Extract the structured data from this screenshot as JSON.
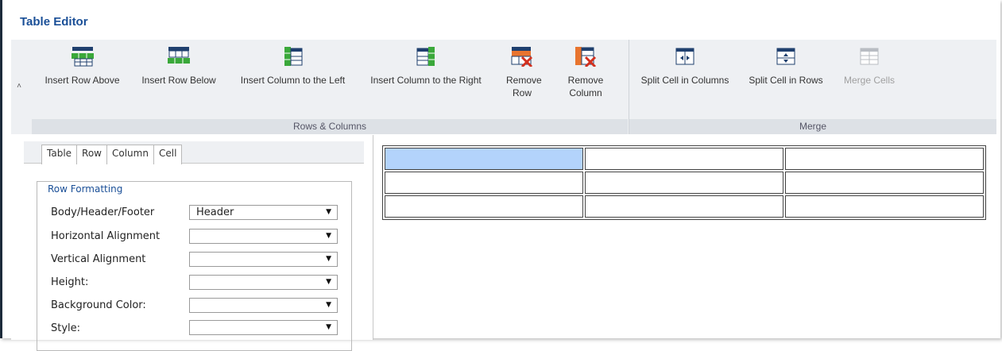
{
  "title": "Table Editor",
  "ribbon": {
    "collapse_glyph": "˄",
    "groups": [
      {
        "label": "Rows & Columns"
      },
      {
        "label": "Merge"
      }
    ],
    "buttons": [
      {
        "label": "Insert Row Above",
        "icon": "insert-row-above-icon"
      },
      {
        "label": "Insert Row Below",
        "icon": "insert-row-below-icon"
      },
      {
        "label": "Insert Column to the Left",
        "icon": "insert-column-left-icon"
      },
      {
        "label": "Insert Column to the Right",
        "icon": "insert-column-right-icon"
      },
      {
        "label": "Remove Row",
        "icon": "remove-row-icon"
      },
      {
        "label": "Remove Column",
        "icon": "remove-column-icon"
      },
      {
        "label": "Split Cell in Columns",
        "icon": "split-columns-icon"
      },
      {
        "label": "Split Cell in Rows",
        "icon": "split-rows-icon"
      },
      {
        "label": "Merge Cells",
        "icon": "merge-cells-icon",
        "disabled": true
      }
    ]
  },
  "tabs": [
    "Table",
    "Row",
    "Column",
    "Cell"
  ],
  "active_tab": "Row",
  "row_formatting": {
    "legend": "Row Formatting",
    "fields": [
      {
        "label": "Body/Header/Footer",
        "value": "Header"
      },
      {
        "label": "Horizontal Alignment",
        "value": ""
      },
      {
        "label": "Vertical Alignment",
        "value": ""
      },
      {
        "label": "Height:",
        "value": ""
      },
      {
        "label": "Background Color:",
        "value": ""
      },
      {
        "label": "Style:",
        "value": ""
      }
    ]
  },
  "dropdown_arrow": "▼",
  "table_preview": {
    "rows": 3,
    "cols": 3,
    "selected_cell": [
      0,
      0
    ]
  },
  "colors": {
    "accent": "#1a4f97",
    "selected_cell": "#b3d3fb",
    "green": "#3aa83a",
    "red": "#d2301e",
    "orange": "#e8742e"
  }
}
